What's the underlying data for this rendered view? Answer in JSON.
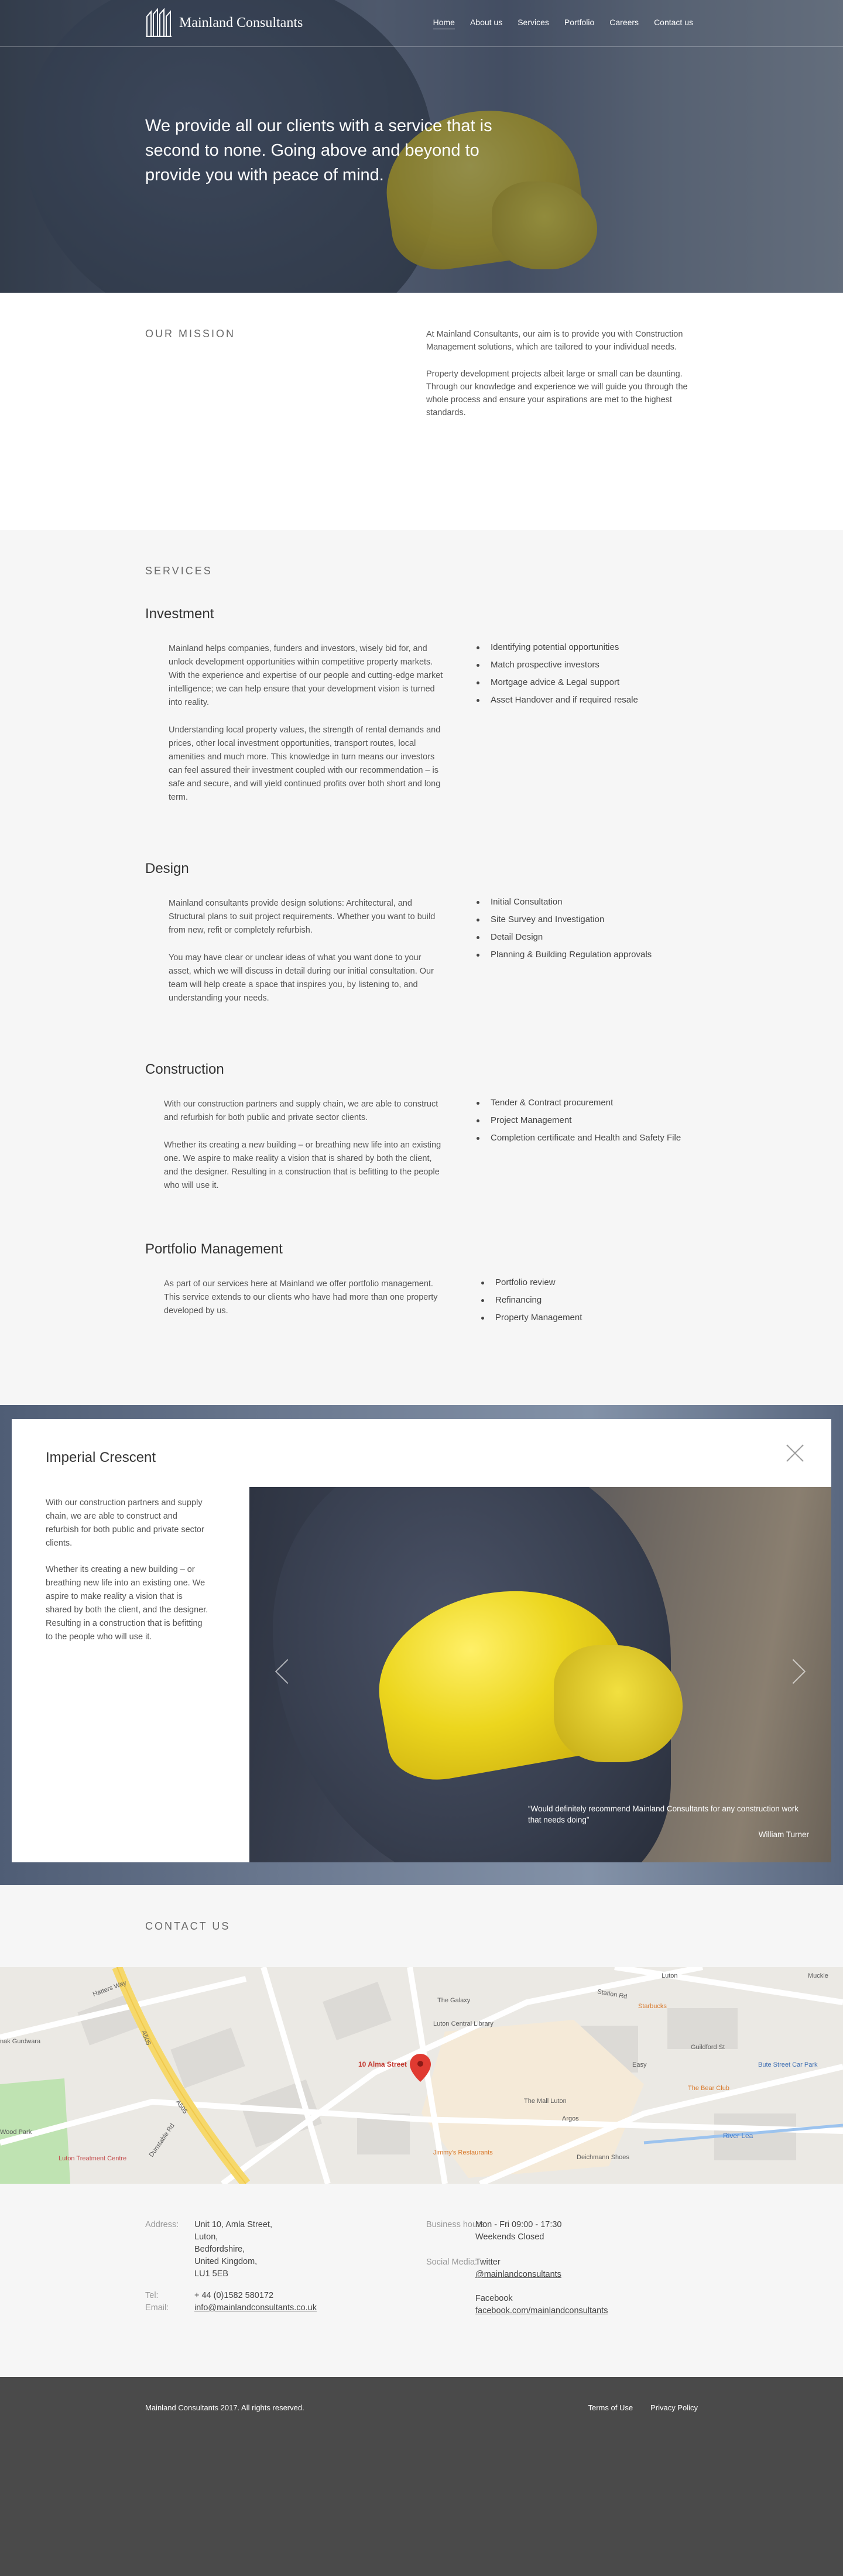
{
  "header": {
    "brand": "Mainland Consultants",
    "nav": [
      {
        "label": "Home",
        "active": true
      },
      {
        "label": "About us"
      },
      {
        "label": "Services"
      },
      {
        "label": "Portfolio"
      },
      {
        "label": "Careers"
      },
      {
        "label": "Contact us"
      }
    ]
  },
  "hero": {
    "headline": "We provide all our clients with a service that is second to none. Going above and beyond to provide you with peace of mind."
  },
  "mission": {
    "title": "OUR MISSION",
    "paragraphs": [
      "At Mainland Consultants, our aim is to provide you with Construction Management solutions, which are tailored to your individual needs.",
      "Property development projects albeit large or small can be daunting. Through our knowledge and experience we will guide you through the whole process and ensure your aspirations are met to the highest standards."
    ]
  },
  "services": {
    "title": "SERVICES",
    "items": [
      {
        "heading": "Investment",
        "paragraphs": [
          "Mainland helps companies, funders and investors, wisely bid for, and unlock development opportunities within competitive property markets. With the experience and expertise of our people and cutting-edge market intelligence; we can help ensure that your development vision is turned into reality.",
          "Understanding local property values, the strength of rental demands and prices, other local investment opportunities, transport routes, local amenities and much more. This knowledge in turn means our investors can feel assured their investment coupled with our recommendation – is safe and secure, and will yield continued profits over both short and long term."
        ],
        "list": [
          "Identifying potential opportunities",
          "Match prospective investors",
          "Mortgage advice & Legal support",
          "Asset Handover and if required resale"
        ]
      },
      {
        "heading": "Design",
        "paragraphs": [
          "Mainland consultants provide design solutions: Architectural, and Structural plans to suit project requirements. Whether you want to build from new, refit or completely refurbish.",
          "You may have clear or unclear ideas of what you want done to your asset, which we will discuss in detail during our initial consultation. Our team will help create a space that inspires you, by listening to, and understanding your needs."
        ],
        "list": [
          "Initial Consultation",
          "Site Survey and Investigation",
          "Detail Design",
          "Planning & Building Regulation approvals"
        ]
      },
      {
        "heading": "Construction",
        "paragraphs": [
          "With our construction partners and supply chain, we are able to construct and refurbish for both public and private sector clients.",
          "Whether its creating a new building – or breathing new life into an existing one. We aspire to make reality a vision that is shared by both the client, and the designer. Resulting in a construction that is befitting to the people who will use it."
        ],
        "list": [
          "Tender & Contract procurement",
          "Project Management",
          "Completion certificate and Health and Safety File"
        ]
      },
      {
        "heading": "Portfolio Management",
        "paragraphs": [
          "As part of our services here at Mainland we offer portfolio management. This service extends to our clients who have had more than one property developed by us."
        ],
        "list": [
          "Portfolio review",
          "Refinancing",
          "Property Management"
        ]
      }
    ]
  },
  "portfolio": {
    "title": "Imperial Crescent",
    "paragraphs": [
      "With our construction partners and supply chain, we are able to construct and refurbish for both public and private sector clients.",
      "Whether its creating a new building – or breathing new life into an existing one. We aspire to make reality a vision that is shared by both the client, and the designer. Resulting in a construction that is befitting to the people who will use it."
    ],
    "quote": "“Would definitely recommend Mainland Consultants for any construction work that needs doing”",
    "quote_author": "William Turner"
  },
  "contact": {
    "title": "CONTACT US",
    "map_labels": {
      "pin": "10 Alma Street",
      "galaxy": "The Galaxy",
      "library": "Luton Central Library",
      "mall": "The Mall Luton",
      "argos": "Argos",
      "jimmys": "Jimmy's Restaurants",
      "starbucks": "Starbucks",
      "bute": "Bute Street Car Park",
      "bear": "The Bear Club",
      "river": "River Lea",
      "debenhams": "Deichmann Shoes",
      "gurdwara": "nak Gurdwara",
      "treatment": "Luton Treatment Centre",
      "wood": "Wood Park",
      "luton": "Luton",
      "easy": "Easy",
      "a505": "A505",
      "a505b": "A505",
      "hatters": "Hatters Way",
      "station": "Station Rd",
      "guildford": "Guildford St",
      "dunstable": "Dunstable Rd",
      "muckle": "Muckle"
    },
    "address_label": "Address:",
    "address_lines": [
      "Unit 10, Amla Street,",
      "Luton,",
      "Bedfordshire,",
      "United Kingdom,",
      "LU1 5EB"
    ],
    "tel_label": "Tel:",
    "tel": "+ 44 (0)1582 580172",
    "email_label": "Email:",
    "email": "info@mainlandconsultants.co.uk",
    "hours_label": "Business hours:",
    "hours_lines": [
      "Mon - Fri 09:00 - 17:30",
      "Weekends Closed"
    ],
    "social_label": "Social Media:",
    "twitter_label": "Twitter",
    "twitter_handle": "@mainlandconsultants",
    "facebook_label": "Facebook",
    "facebook_url": "facebook.com/mainlandconsultants"
  },
  "footer": {
    "copyright": "Mainland Consultants 2017. All rights reserved.",
    "links": [
      "Terms of Use",
      "Privacy Policy"
    ]
  }
}
